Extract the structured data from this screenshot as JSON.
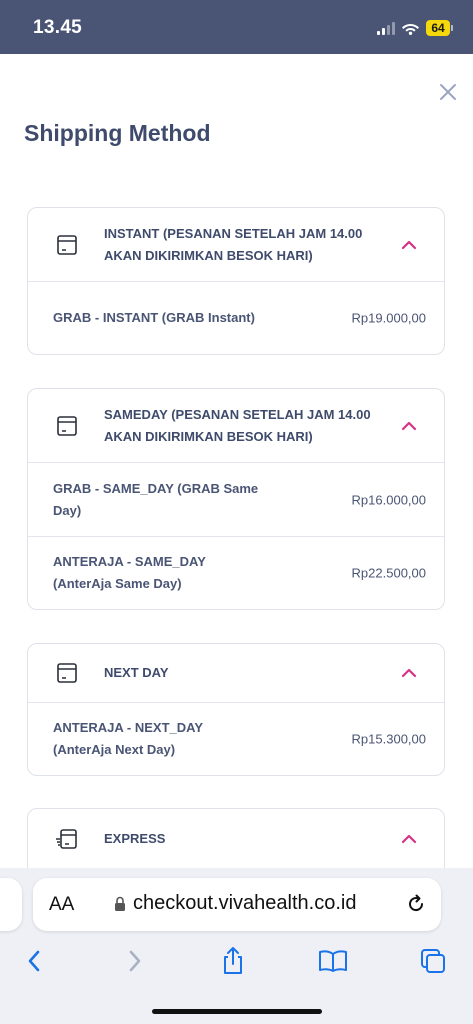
{
  "status_bar": {
    "time": "13.45",
    "battery": "64"
  },
  "sheet": {
    "title": "Shipping Method",
    "groups": [
      {
        "label": "INSTANT (PESANAN SETELAH JAM 14.00 AKAN DIKIRIMKAN BESOK HARI)",
        "options": [
          {
            "name": "GRAB - INSTANT (GRAB Instant)",
            "price": "Rp19.000,00"
          }
        ]
      },
      {
        "label": "SAMEDAY (PESANAN SETELAH JAM 14.00 AKAN DIKIRIMKAN BESOK HARI)",
        "options": [
          {
            "name": "GRAB - SAME_DAY (GRAB Same Day)",
            "price": "Rp16.000,00"
          },
          {
            "name": "ANTERAJA - SAME_DAY (AnterAja Same Day)",
            "price": "Rp22.500,00"
          }
        ]
      },
      {
        "label": "NEXT DAY",
        "options": [
          {
            "name": "ANTERAJA - NEXT_DAY (AnterAja Next Day)",
            "price": "Rp15.300,00"
          }
        ]
      },
      {
        "label": "EXPRESS",
        "options": []
      }
    ]
  },
  "browser": {
    "aa_label": "AA",
    "url": "checkout.vivahealth.co.id"
  },
  "colors": {
    "status_bar": "#4a5576",
    "accent_chevron": "#d63384",
    "text_dark": "#3f4b6c",
    "safari_blue": "#1a73e8",
    "battery": "#f5d90a"
  },
  "icons": [
    "signal-icon",
    "wifi-icon",
    "battery-icon",
    "close-icon",
    "package-icon",
    "express-package-icon",
    "chevron-up-icon",
    "lock-icon",
    "reload-icon",
    "back-icon",
    "forward-icon",
    "share-icon",
    "bookmarks-icon",
    "tabs-icon"
  ]
}
